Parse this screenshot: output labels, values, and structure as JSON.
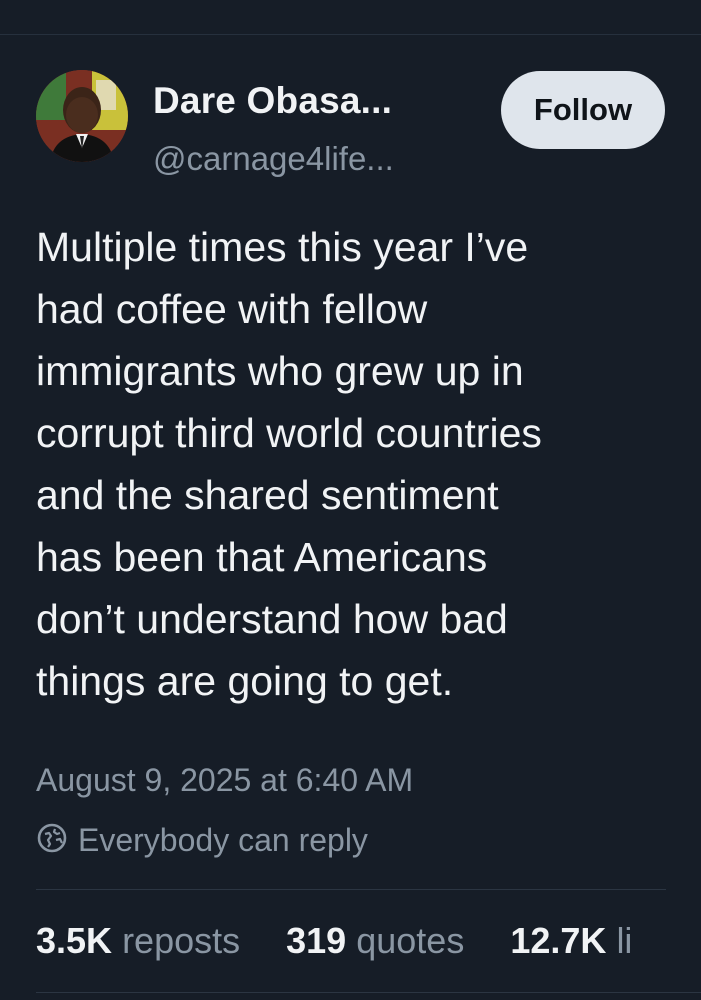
{
  "author": {
    "name": "Dare Obasa...",
    "handle": "@carnage4life..."
  },
  "follow_label": "Follow",
  "post": {
    "lines": [
      "Multiple times this year I’ve",
      "had coffee with fellow",
      "immigrants who grew up in",
      "corrupt third world countries",
      "and the shared sentiment",
      "has been that Americans",
      "don’t understand how bad",
      "things are going to get."
    ]
  },
  "timestamp": "August 9, 2025 at 6:40 AM",
  "reply_setting": {
    "icon": "globe-icon",
    "label": "Everybody can reply"
  },
  "stats": [
    {
      "value": "3.5K",
      "label": "reposts"
    },
    {
      "value": "319",
      "label": "quotes"
    },
    {
      "value": "12.7K",
      "label": "li"
    }
  ],
  "colors": {
    "background": "#161d27",
    "primary_text": "#f1f3f5",
    "secondary_text": "#8a96a3",
    "follow_button_bg": "#dfe5ec"
  }
}
